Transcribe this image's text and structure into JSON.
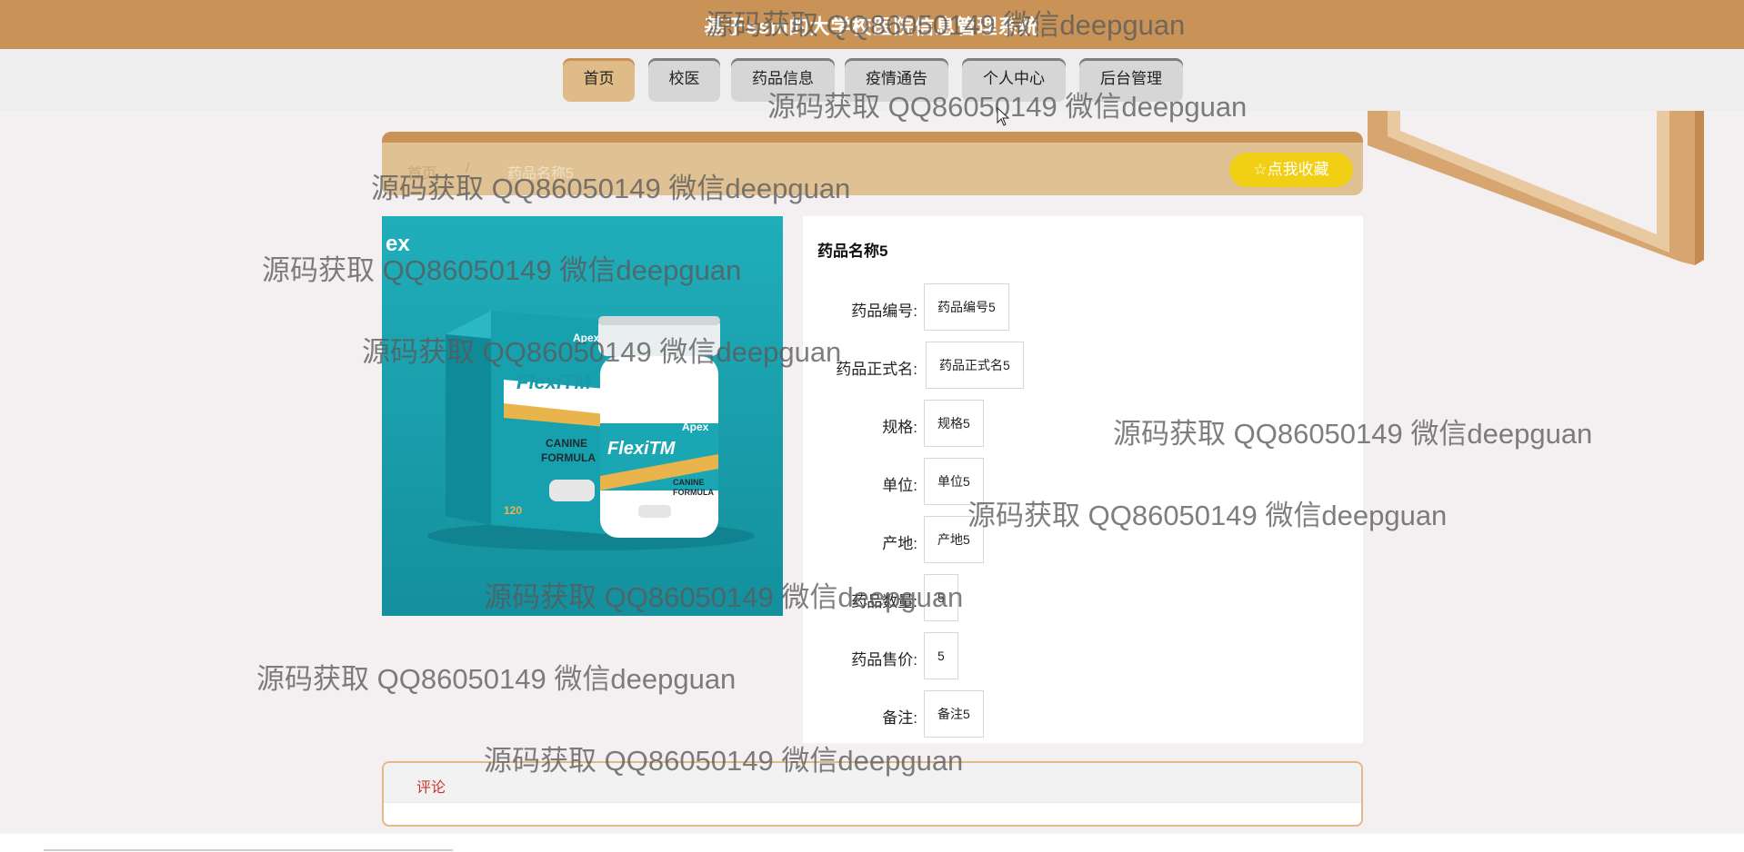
{
  "header": {
    "title": "基于ssm的大学校医院信息管理系统"
  },
  "nav": {
    "items": [
      {
        "label": "首页",
        "active": true
      },
      {
        "label": "校医",
        "active": false
      },
      {
        "label": "药品信息",
        "active": false
      },
      {
        "label": "疫情通告",
        "active": false
      },
      {
        "label": "个人中心",
        "active": false
      },
      {
        "label": "后台管理",
        "active": false
      }
    ]
  },
  "breadcrumb": {
    "home": "首页",
    "separator": "/",
    "current": "药品名称5"
  },
  "favorite_button": {
    "label": "☆点我收藏"
  },
  "product_image": {
    "brand": "Apex",
    "product": "FlexiTM",
    "line1": "CANINE",
    "line2": "FORMULA",
    "count": "120",
    "edge_text": "ex"
  },
  "detail": {
    "title": "药品名称5",
    "fields": [
      {
        "label": "药品编号:",
        "value": "药品编号5"
      },
      {
        "label": "药品正式名:",
        "value": "药品正式名5"
      },
      {
        "label": "规格:",
        "value": "规格5"
      },
      {
        "label": "单位:",
        "value": "单位5"
      },
      {
        "label": "产地:",
        "value": "产地5"
      },
      {
        "label": "药品数量:",
        "value": "5"
      },
      {
        "label": "药品售价:",
        "value": "5"
      },
      {
        "label": "备注:",
        "value": "备注5"
      }
    ]
  },
  "comments": {
    "tab_label": "评论"
  },
  "watermark": {
    "text": "源码获取 QQ86050149 微信deepguan"
  },
  "colors": {
    "topbar": "#c99357",
    "nav_active": "#dfbb87",
    "crumbbar": "#dfc193",
    "favorite": "#f0cf14",
    "product_bg": "#1ba7b5",
    "comment_tab": "#c8342a"
  }
}
